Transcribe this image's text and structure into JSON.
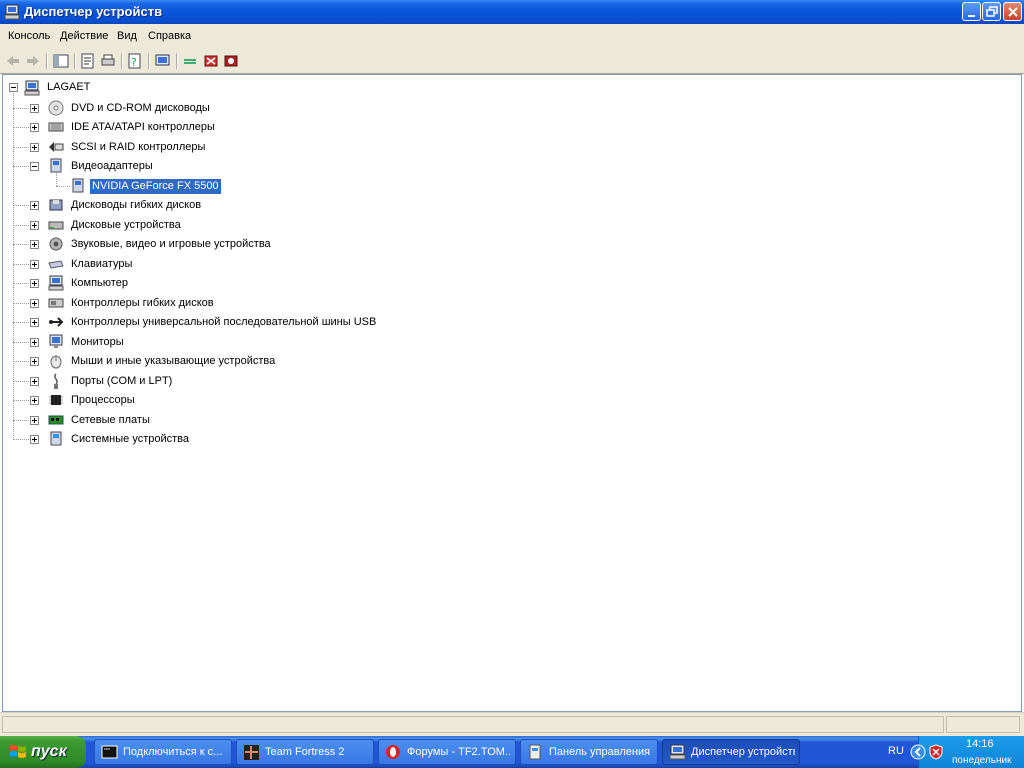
{
  "window": {
    "title": "Диспетчер устройств"
  },
  "menu": [
    "Консоль",
    "Действие",
    "Вид",
    "Справка"
  ],
  "tree": {
    "root": "LAGAET",
    "items": [
      {
        "label": "DVD и CD-ROM дисководы",
        "icon": "cdrom-icon"
      },
      {
        "label": "IDE ATA/ATAPI контроллеры",
        "icon": "ide-controller-icon"
      },
      {
        "label": "SCSI и RAID контроллеры",
        "icon": "scsi-controller-icon"
      },
      {
        "label": "Видеоадаптеры",
        "icon": "display-adapter-icon",
        "expanded": true,
        "children": [
          {
            "label": "NVIDIA GeForce FX 5500",
            "icon": "display-adapter-icon",
            "selected": true
          }
        ]
      },
      {
        "label": "Дисководы гибких дисков",
        "icon": "floppy-drive-icon"
      },
      {
        "label": "Дисковые устройства",
        "icon": "disk-drive-icon"
      },
      {
        "label": "Звуковые, видео и игровые устройства",
        "icon": "sound-device-icon"
      },
      {
        "label": "Клавиатуры",
        "icon": "keyboard-icon"
      },
      {
        "label": "Компьютер",
        "icon": "computer-icon"
      },
      {
        "label": "Контроллеры гибких дисков",
        "icon": "floppy-controller-icon"
      },
      {
        "label": "Контроллеры универсальной последовательной шины USB",
        "icon": "usb-icon"
      },
      {
        "label": "Мониторы",
        "icon": "monitor-icon"
      },
      {
        "label": "Мыши и иные указывающие устройства",
        "icon": "mouse-icon"
      },
      {
        "label": "Порты (COM и LPT)",
        "icon": "port-icon"
      },
      {
        "label": "Процессоры",
        "icon": "processor-icon"
      },
      {
        "label": "Сетевые платы",
        "icon": "network-card-icon"
      },
      {
        "label": "Системные устройства",
        "icon": "system-device-icon"
      }
    ]
  },
  "taskbar": {
    "start": "пуск",
    "tasks": [
      {
        "label": "Подключиться к с...",
        "icon": "console-icon",
        "active": false
      },
      {
        "label": "Team Fortress 2",
        "icon": "tf2-icon",
        "active": false
      },
      {
        "label": "Форумы - TF2.TOM...",
        "icon": "opera-icon",
        "active": false
      },
      {
        "label": "Панель управления",
        "icon": "control-panel-icon",
        "active": false
      },
      {
        "label": "Диспетчер устройств",
        "icon": "device-manager-icon",
        "active": true
      }
    ],
    "lang": "RU",
    "time": "14:16",
    "day": "понедельник"
  }
}
